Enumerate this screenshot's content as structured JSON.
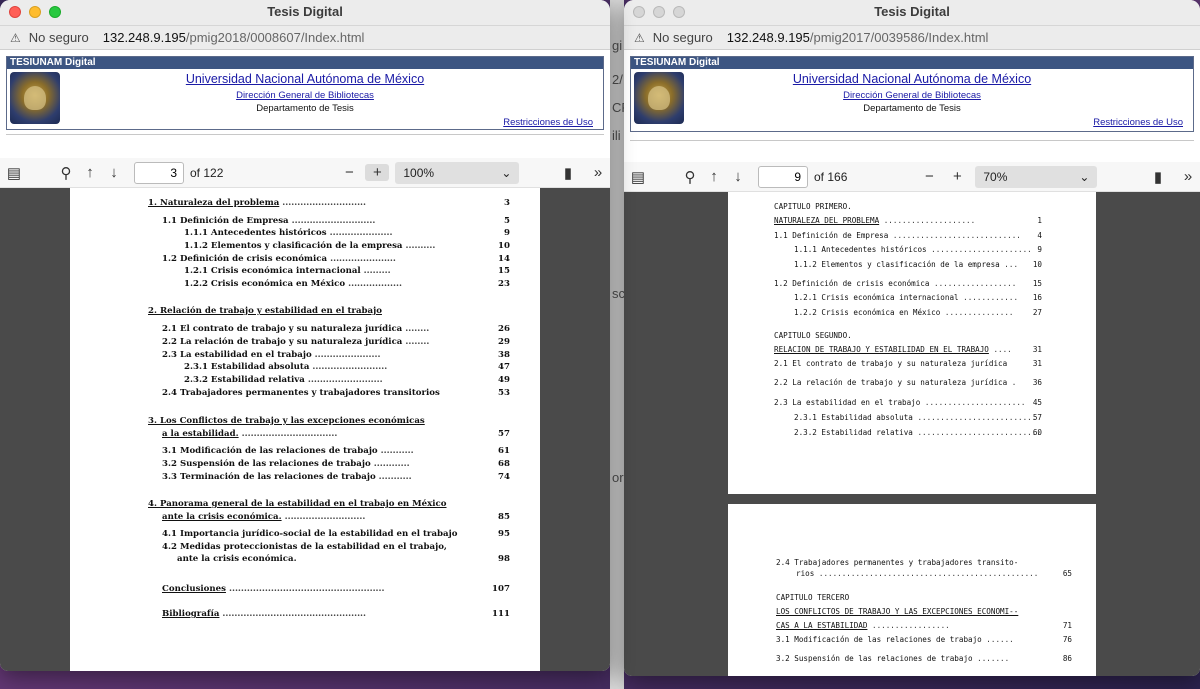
{
  "background_fragments": [
    "gi",
    "2/",
    "CF",
    "ili",
    "sche",
    "or"
  ],
  "left": {
    "window_title": "Tesis Digital",
    "address": {
      "security": "No seguro",
      "host": "132.248.9.195",
      "path": "/pmig2018/0008607/Index.html"
    },
    "header": {
      "bar": "TESIUNAM Digital",
      "title": "Universidad Nacional Autónoma de México",
      "subtitle": "Dirección General de Bibliotecas",
      "dept": "Departamento de Tesis",
      "restrictions": "Restricciones de Uso"
    },
    "toolbar": {
      "page": "3",
      "of": "of 122",
      "zoom": "100%"
    },
    "toc": [
      {
        "t": "1. Naturaleza del problema",
        "n": "3"
      },
      {
        "t": "1.1 Definición de Empresa",
        "n": "5"
      },
      {
        "t": "1.1.1 Antecedentes históricos",
        "n": "9"
      },
      {
        "t": "1.1.2 Elementos y clasificación de la empresa",
        "n": "10"
      },
      {
        "t": "1.2 Definición de crisis económica",
        "n": "14"
      },
      {
        "t": "1.2.1 Crisis económica internacional",
        "n": "15"
      },
      {
        "t": "1.2.2 Crisis económica en México",
        "n": "23"
      },
      {
        "t": "2. Relación de trabajo y estabilidad en el trabajo",
        "n": ""
      },
      {
        "t": "2.1 El contrato de trabajo y su naturaleza jurídica",
        "n": "26"
      },
      {
        "t": "2.2 La relación de trabajo y su naturaleza jurídica",
        "n": "29"
      },
      {
        "t": "2.3 La estabilidad en el trabajo",
        "n": "38"
      },
      {
        "t": "2.3.1 Estabilidad absoluta",
        "n": "47"
      },
      {
        "t": "2.3.2 Estabilidad relativa",
        "n": "49"
      },
      {
        "t": "2.4 Trabajadores permanentes y trabajadores transitorios",
        "n": "53"
      },
      {
        "t": "3. Los Conflictos de trabajo y las excepciones económicas",
        "n": ""
      },
      {
        "t": "a la estabilidad.",
        "n": "57"
      },
      {
        "t": "3.1 Modificación de las relaciones de trabajo",
        "n": "61"
      },
      {
        "t": "3.2 Suspensión de las relaciones de trabajo",
        "n": "68"
      },
      {
        "t": "3.3 Terminación de las relaciones de trabajo",
        "n": "74"
      },
      {
        "t": "4. Panorama general de la estabilidad en el trabajo en México",
        "n": ""
      },
      {
        "t": "ante la crisis económica.",
        "n": "85"
      },
      {
        "t": "4.1 Importancia jurídico-social de la estabilidad en el trabajo",
        "n": "95"
      },
      {
        "t": "4.2 Medidas proteccionistas de la estabilidad en el trabajo,",
        "n": ""
      },
      {
        "t": "ante la crisis económica.",
        "n": "98"
      },
      {
        "t": "Conclusiones",
        "n": "107"
      },
      {
        "t": "Bibliografía",
        "n": "111"
      }
    ]
  },
  "right": {
    "window_title": "Tesis Digital",
    "address": {
      "security": "No seguro",
      "host": "132.248.9.195",
      "path": "/pmig2017/0039586/Index.html"
    },
    "header": {
      "bar": "TESIUNAM Digital",
      "title": "Universidad Nacional Autónoma de México",
      "subtitle": "Dirección General de Bibliotecas",
      "dept": "Departamento de Tesis",
      "restrictions": "Restricciones de Uso"
    },
    "toolbar": {
      "page": "9",
      "of": "of 166",
      "zoom": "70%"
    },
    "toc": [
      {
        "t": "CAPITULO  PRIMERO.",
        "n": ""
      },
      {
        "t": "NATURALEZA DEL PROBLEMA",
        "n": "1"
      },
      {
        "t": "1.1 Definición de Empresa",
        "n": "4"
      },
      {
        "t": "1.1.1 Antecedentes históricos",
        "n": "9"
      },
      {
        "t": "1.1.2 Elementos y clasificación de la empresa",
        "n": "10"
      },
      {
        "t": "1.2 Definición de crisis económica",
        "n": "15"
      },
      {
        "t": "1.2.1 Crisis económica internacional",
        "n": "16"
      },
      {
        "t": "1.2.2 Crisis económica en México",
        "n": "27"
      },
      {
        "t": "CAPITULO SEGUNDO.",
        "n": ""
      },
      {
        "t": "RELACION DE TRABAJO Y ESTABILIDAD EN EL TRABAJO",
        "n": "31"
      },
      {
        "t": "2.1 El contrato de trabajo y su naturaleza jurídica",
        "n": "31"
      },
      {
        "t": "2.2 La relación de trabajo y su naturaleza jurídica",
        "n": "36"
      },
      {
        "t": "2.3 La estabilidad en el trabajo",
        "n": "45"
      },
      {
        "t": "2.3.1 Estabilidad absoluta",
        "n": "57"
      },
      {
        "t": "2.3.2 Estabilidad relativa",
        "n": "60"
      }
    ],
    "toc2": [
      {
        "t": "2.4 Trabajadores permanentes y trabajadores transito-",
        "n": ""
      },
      {
        "t": "rios",
        "n": "65"
      },
      {
        "t": "CAPITULO TERCERO",
        "n": ""
      },
      {
        "t": "LOS CONFLICTOS DE TRABAJO Y LAS EXCEPCIONES ECONOMI--",
        "n": ""
      },
      {
        "t": "CAS A LA ESTABILIDAD",
        "n": "71"
      },
      {
        "t": "3.1 Modificación de las relaciones de trabajo",
        "n": "76"
      },
      {
        "t": "3.2 Suspensión de las relaciones de trabajo",
        "n": "86"
      }
    ]
  }
}
